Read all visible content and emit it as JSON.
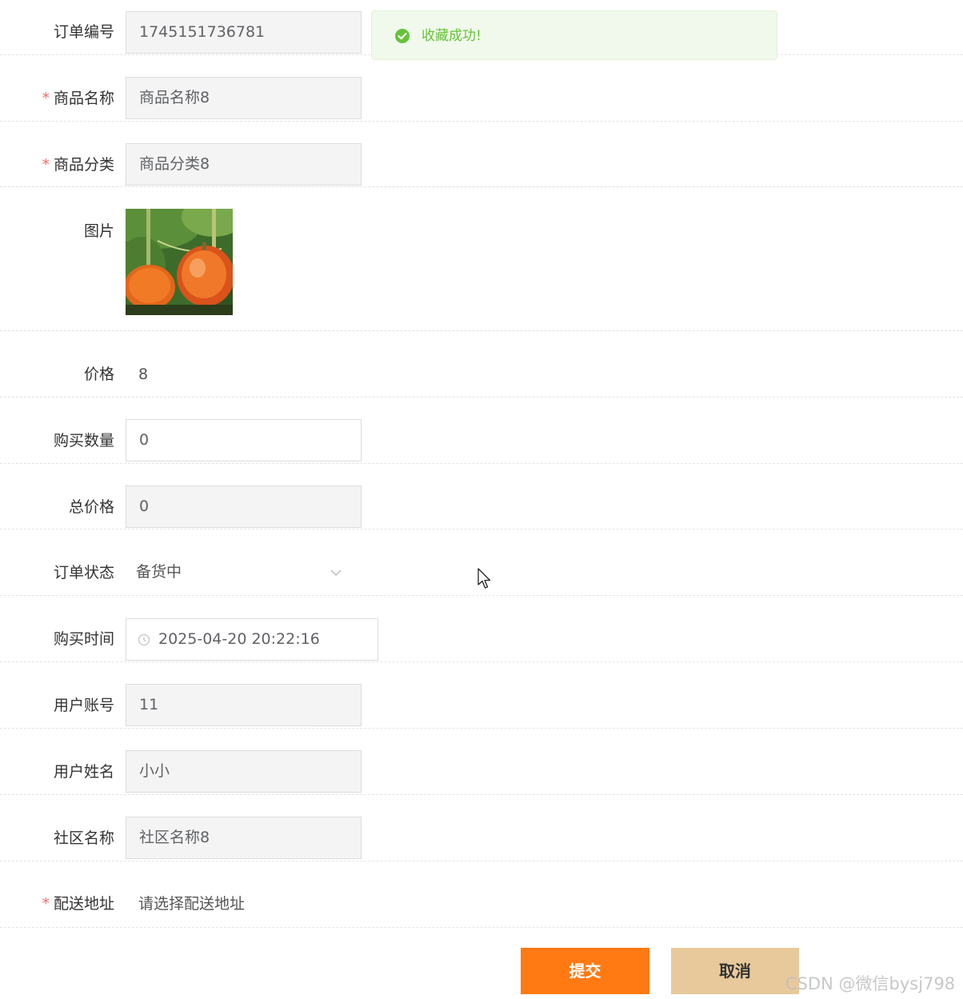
{
  "toast": {
    "message": "收藏成功!",
    "icon": "check-circle-icon",
    "color": "#67c23a"
  },
  "form": {
    "order_no": {
      "label": "订单编号",
      "value": "1745151736781",
      "required": false
    },
    "product_name": {
      "label": "商品名称",
      "value": "商品名称8",
      "required": true
    },
    "product_category": {
      "label": "商品分类",
      "value": "商品分类8",
      "required": true
    },
    "image": {
      "label": "图片",
      "alt": "pumpkin-image"
    },
    "price": {
      "label": "价格",
      "value": "8"
    },
    "quantity": {
      "label": "购买数量",
      "value": "0"
    },
    "total_price": {
      "label": "总价格",
      "value": "0"
    },
    "order_status": {
      "label": "订单状态",
      "value": "备货中"
    },
    "purchase_time": {
      "label": "购买时间",
      "value": "2025-04-20 20:22:16"
    },
    "user_account": {
      "label": "用户账号",
      "value": "11"
    },
    "user_name": {
      "label": "用户姓名",
      "value": "小小"
    },
    "community_name": {
      "label": "社区名称",
      "value": "社区名称8"
    },
    "delivery_address": {
      "label": "配送地址",
      "placeholder": "请选择配送地址",
      "required": true
    }
  },
  "buttons": {
    "submit": "提交",
    "cancel": "取消"
  },
  "required_mark": "*",
  "watermark": "CSDN @微信bysj798",
  "colors": {
    "submit_bg": "#ff7a12",
    "cancel_bg": "#e8c99c",
    "required": "#f56c6c",
    "success": "#67c23a"
  }
}
